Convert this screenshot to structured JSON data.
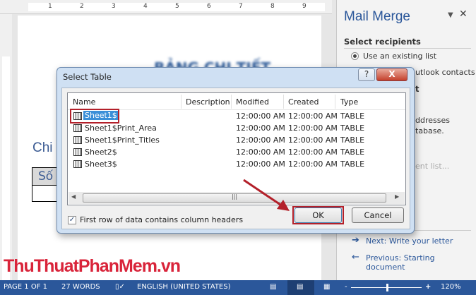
{
  "ruler": {
    "h_numbers": [
      "1",
      "2",
      "3",
      "4",
      "5",
      "6",
      "7",
      "8",
      "9"
    ]
  },
  "document": {
    "heading": "BẢNG CHI TIẾT LƯƠNG",
    "subheading": "Chi",
    "table_header": "Số"
  },
  "pane": {
    "title": "Mail Merge",
    "section": "Select recipients",
    "option1": "Use an existing list",
    "option2_partial": "utlook contacts",
    "section2_partial": "t",
    "desc1": "ddresses",
    "desc2": "tabase.",
    "edit_partial": "ent list...",
    "next": "Next: Write your letter",
    "previous": "Previous: Starting document"
  },
  "dialog": {
    "title": "Select Table",
    "columns": [
      "Name",
      "Description",
      "Modified",
      "Created",
      "Type"
    ],
    "rows": [
      {
        "name": "Sheet1$",
        "description": "",
        "modified": "12:00:00 AM",
        "created": "12:00:00 AM",
        "type": "TABLE"
      },
      {
        "name": "Sheet1$Print_Area",
        "description": "",
        "modified": "12:00:00 AM",
        "created": "12:00:00 AM",
        "type": "TABLE"
      },
      {
        "name": "Sheet1$Print_Titles",
        "description": "",
        "modified": "12:00:00 AM",
        "created": "12:00:00 AM",
        "type": "TABLE"
      },
      {
        "name": "Sheet2$",
        "description": "",
        "modified": "12:00:00 AM",
        "created": "12:00:00 AM",
        "type": "TABLE"
      },
      {
        "name": "Sheet3$",
        "description": "",
        "modified": "12:00:00 AM",
        "created": "12:00:00 AM",
        "type": "TABLE"
      }
    ],
    "checkbox_label": "First row of data contains column headers",
    "checkbox_checked": true,
    "ok": "OK",
    "cancel": "Cancel",
    "help": "?",
    "close": "X"
  },
  "status": {
    "page": "PAGE 1 OF 1",
    "words": "27 WORDS",
    "language": "ENGLISH (UNITED STATES)",
    "zoom": "120%",
    "zoom_minus": "-",
    "zoom_plus": "+"
  },
  "watermark": "ThuThuatPhanMem.vn",
  "colors": {
    "accent": "#2b579a",
    "highlight": "#b3202a"
  }
}
